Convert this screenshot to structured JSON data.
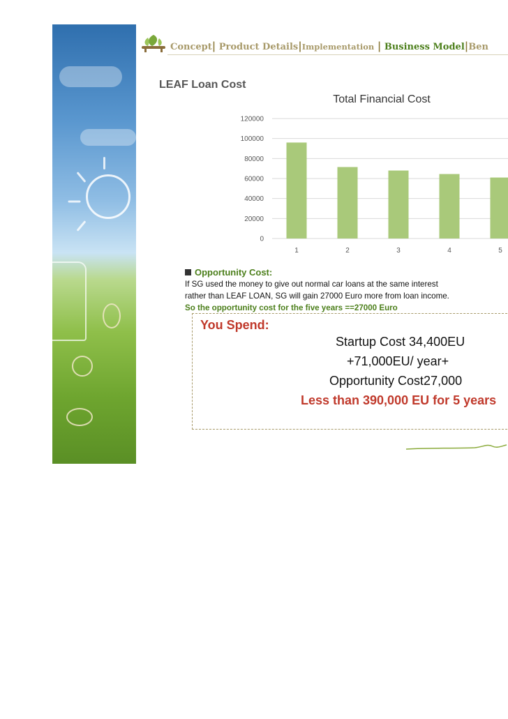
{
  "nav": {
    "items": [
      {
        "label": "Concept",
        "active": false
      },
      {
        "label": "Product Details",
        "active": false
      },
      {
        "label": "Implementation",
        "active": false
      },
      {
        "label": "Business Model",
        "active": true
      },
      {
        "label": "Ben",
        "active": false
      }
    ],
    "separator": "|"
  },
  "page_title": "LEAF Loan Cost",
  "chart_data": {
    "type": "bar",
    "title": "Total Financial Cost",
    "categories": [
      "1",
      "2",
      "3",
      "4",
      "5"
    ],
    "values": [
      96000,
      71500,
      68000,
      64500,
      61000
    ],
    "y_ticks": [
      "0",
      "20000",
      "40000",
      "60000",
      "80000",
      "100000",
      "120000"
    ],
    "ylim": [
      0,
      120000
    ],
    "xlabel": "",
    "ylabel": "",
    "grid": true,
    "bar_color": "#a9c97a"
  },
  "opportunity": {
    "heading": "Opportunity Cost:",
    "line1": "If SG used the money to give out normal car loans at the same interest",
    "line2": "rather than LEAF LOAN, SG will gain 27000 Euro more from loan income.",
    "conclusion": "So the opportunity cost for the five years ==27000 Euro"
  },
  "spend": {
    "label": "You Spend:",
    "startup": "Startup Cost 34,400EU",
    "yearly": "+71,000EU/ year+",
    "opportunity": "Opportunity Cost27,000",
    "total": "Less than 390,000 EU for 5 years"
  },
  "colors": {
    "accent_green": "#4c7f1b",
    "nav_muted": "#a89a6a",
    "highlight_red": "#c0392b"
  }
}
